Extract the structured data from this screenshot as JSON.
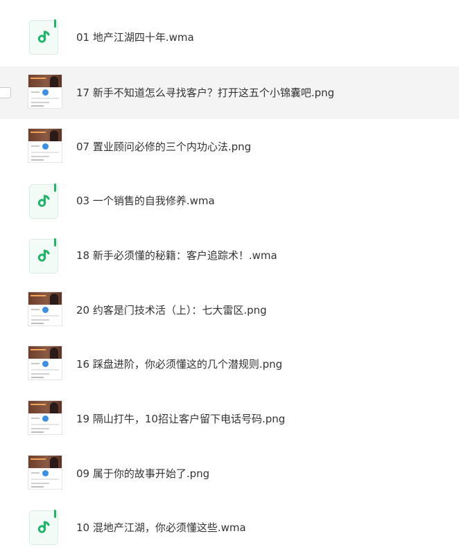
{
  "files": [
    {
      "name": "01 地产江湖四十年.wma",
      "type": "audio",
      "icon": "music-note-icon",
      "selected": false
    },
    {
      "name": "17 新手不知道怎么寻找客户？打开这五个小锦囊吧.png",
      "type": "image",
      "icon": "image-thumbnail",
      "selected": true
    },
    {
      "name": "07 置业顾问必修的三个内功心法.png",
      "type": "image",
      "icon": "image-thumbnail",
      "selected": false
    },
    {
      "name": "03 一个销售的自我修养.wma",
      "type": "audio",
      "icon": "music-note-icon",
      "selected": false
    },
    {
      "name": "18 新手必须懂的秘籍：客户追踪术！.wma",
      "type": "audio",
      "icon": "music-note-icon",
      "selected": false
    },
    {
      "name": "20 约客是门技术活（上）：七大雷区.png",
      "type": "image",
      "icon": "image-thumbnail",
      "selected": false
    },
    {
      "name": "16 踩盘进阶，你必须懂这的几个潜规则.png",
      "type": "image",
      "icon": "image-thumbnail",
      "selected": false
    },
    {
      "name": "19 隔山打牛，10招让客户留下电话号码.png",
      "type": "image",
      "icon": "image-thumbnail",
      "selected": false
    },
    {
      "name": "09 属于你的故事开始了.png",
      "type": "image",
      "icon": "image-thumbnail",
      "selected": false
    },
    {
      "name": "10 混地产江湖，你必须懂这些.wma",
      "type": "audio",
      "icon": "music-note-icon",
      "selected": false
    }
  ],
  "colors": {
    "audio_accent": "#21b56b",
    "selected_row_bg": "#f4f4f4",
    "text": "#333333"
  }
}
